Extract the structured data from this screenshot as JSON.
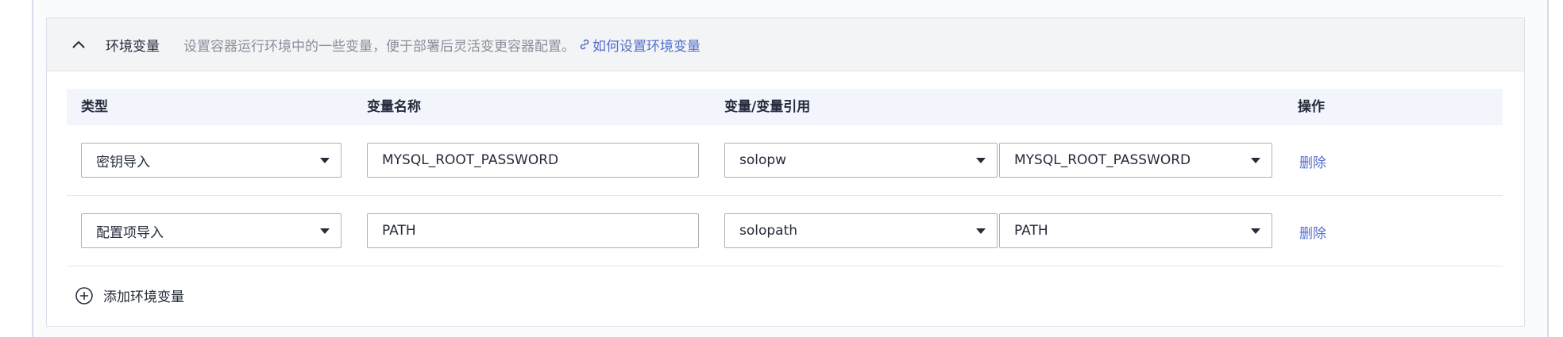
{
  "section": {
    "title": "环境变量",
    "description": "设置容器运行环境中的一些变量，便于部署后灵活变更容器配置。",
    "help_link": "如何设置环境变量"
  },
  "table": {
    "columns": [
      "类型",
      "变量名称",
      "变量/变量引用",
      "操作"
    ],
    "rows": [
      {
        "type": "密钥导入",
        "name": "MYSQL_ROOT_PASSWORD",
        "ref_source": "solopw",
        "ref_key": "MYSQL_ROOT_PASSWORD",
        "action": "删除"
      },
      {
        "type": "配置项导入",
        "name": "PATH",
        "ref_source": "solopath",
        "ref_key": "PATH",
        "action": "删除"
      }
    ]
  },
  "add_button": "添加环境变量",
  "colors": {
    "link": "#526ecc",
    "header_bg": "#f3f4f6",
    "table_header_bg": "#f2f5fc",
    "border": "#adb0b8"
  }
}
